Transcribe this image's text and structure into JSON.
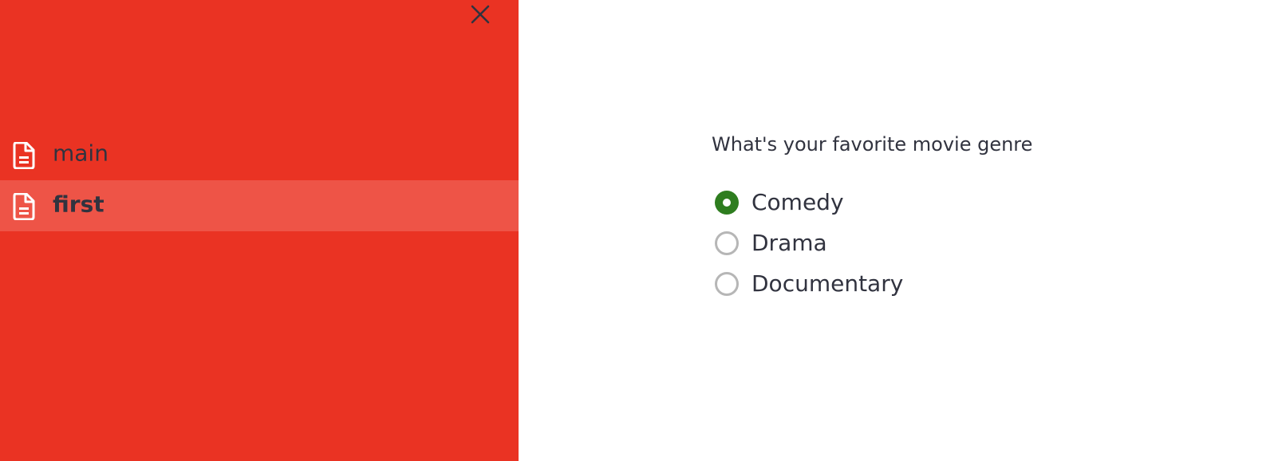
{
  "sidebar": {
    "background_color": "#ea3323",
    "active_background_color": "#ee5447",
    "close_icon": "close-icon",
    "items": [
      {
        "label": "main",
        "icon": "page-icon",
        "active": false
      },
      {
        "label": "first",
        "icon": "page-icon",
        "active": true
      }
    ]
  },
  "main": {
    "radio_group": {
      "question": "What's your favorite movie genre",
      "options": [
        {
          "label": "Comedy",
          "selected": true
        },
        {
          "label": "Drama",
          "selected": false
        },
        {
          "label": "Documentary",
          "selected": false
        }
      ],
      "selected_color": "#2e7d1f"
    }
  }
}
